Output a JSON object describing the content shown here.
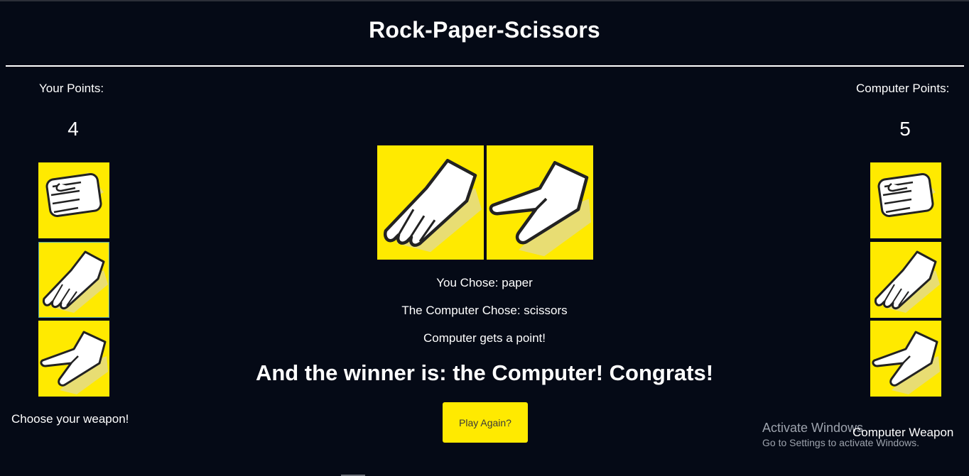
{
  "title": "Rock-Paper-Scissors",
  "player": {
    "points_label": "Your Points:",
    "points": "4",
    "weapons": [
      "rock",
      "paper",
      "scissors"
    ],
    "selected": "paper",
    "choose_label": "Choose your weapon!"
  },
  "computer": {
    "points_label": "Computer Points:",
    "points": "5",
    "weapons": [
      "rock",
      "paper",
      "scissors"
    ],
    "weapon_label": "Computer Weapon"
  },
  "round": {
    "you_chose": "You Chose: paper",
    "computer_chose": "The Computer Chose: scissors",
    "result": "Computer gets a point!",
    "winner": "And the winner is: the Computer! Congrats!"
  },
  "play_again_label": "Play Again?",
  "watermark": {
    "line1": "Activate Windows",
    "line2": "Go to Settings to activate Windows."
  },
  "colors": {
    "background": "#050a16",
    "accent": "#ffea00",
    "text": "#ffffff"
  }
}
